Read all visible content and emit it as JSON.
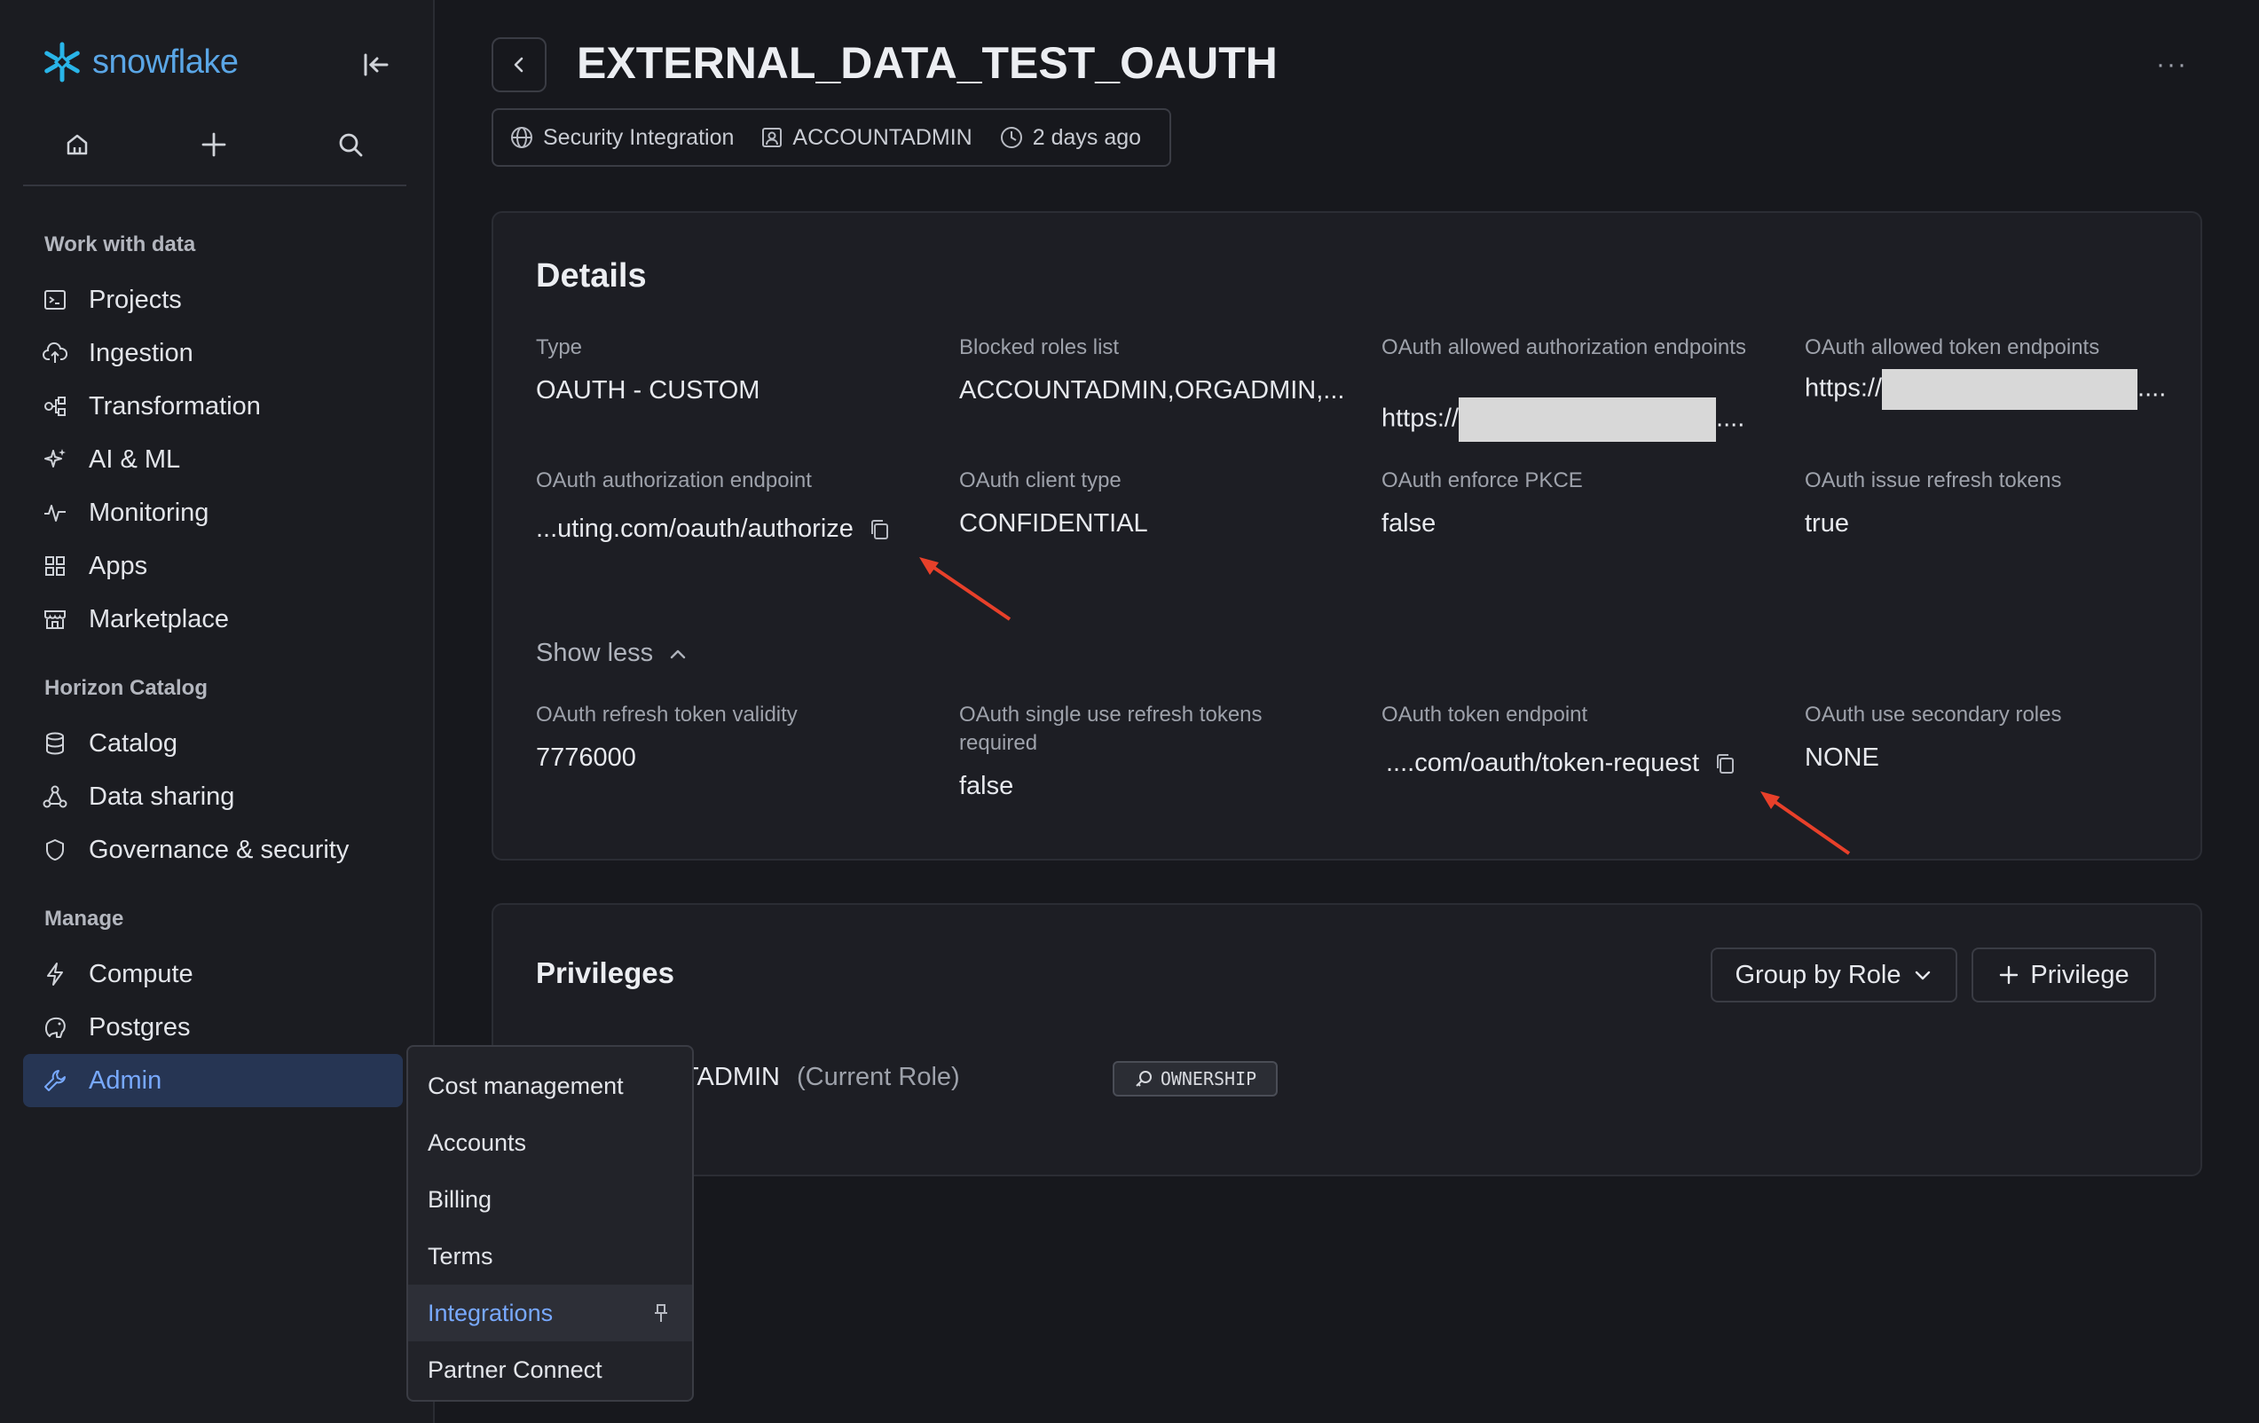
{
  "app": {
    "logo_text": "snowflake"
  },
  "sidebar": {
    "sections": [
      {
        "label": "Work with data"
      },
      {
        "label": "Horizon Catalog"
      },
      {
        "label": "Manage"
      }
    ],
    "items": [
      {
        "label": "Projects",
        "icon": "terminal-icon"
      },
      {
        "label": "Ingestion",
        "icon": "cloud-upload-icon"
      },
      {
        "label": "Transformation",
        "icon": "transform-icon"
      },
      {
        "label": "AI & ML",
        "icon": "sparkle-icon"
      },
      {
        "label": "Monitoring",
        "icon": "activity-icon"
      },
      {
        "label": "Apps",
        "icon": "grid-icon"
      },
      {
        "label": "Marketplace",
        "icon": "store-icon"
      },
      {
        "label": "Catalog",
        "icon": "database-icon"
      },
      {
        "label": "Data sharing",
        "icon": "share-icon"
      },
      {
        "label": "Governance & security",
        "icon": "shield-icon"
      },
      {
        "label": "Compute",
        "icon": "bolt-icon"
      },
      {
        "label": "Postgres",
        "icon": "elephant-icon"
      },
      {
        "label": "Admin",
        "icon": "wrench-icon",
        "active": true
      }
    ]
  },
  "submenu": {
    "items": [
      {
        "label": "Cost management"
      },
      {
        "label": "Accounts"
      },
      {
        "label": "Billing"
      },
      {
        "label": "Terms"
      },
      {
        "label": "Integrations",
        "active": true
      },
      {
        "label": "Partner Connect"
      }
    ]
  },
  "header": {
    "title": "EXTERNAL_DATA_TEST_OAUTH",
    "more": "···",
    "meta": [
      {
        "label": "Security Integration",
        "icon": "globe-icon"
      },
      {
        "label": "ACCOUNTADMIN",
        "icon": "user-badge-icon"
      },
      {
        "label": "2 days ago",
        "icon": "clock-icon"
      }
    ]
  },
  "details": {
    "title": "Details",
    "fields": [
      {
        "label": "Type",
        "value": "OAUTH - CUSTOM"
      },
      {
        "label": "Blocked roles list",
        "value": "ACCOUNTADMIN,ORGADMIN,..."
      },
      {
        "label": "OAuth allowed authorization endpoints",
        "value_prefix": "https://",
        "value_suffix": "...."
      },
      {
        "label": "OAuth allowed token endpoints",
        "value_prefix": "https://",
        "value_suffix": "...."
      },
      {
        "label": "OAuth authorization endpoint",
        "value": "...uting.com/oauth/authorize"
      },
      {
        "label": "OAuth client type",
        "value": "CONFIDENTIAL"
      },
      {
        "label": "OAuth enforce PKCE",
        "value": "false"
      },
      {
        "label": "OAuth issue refresh tokens",
        "value": "true"
      },
      {
        "label": "OAuth refresh token validity",
        "value": "7776000"
      },
      {
        "label": "OAuth single use refresh tokens required",
        "value": "false"
      },
      {
        "label": "OAuth token endpoint",
        "value": "....com/oauth/token-request"
      },
      {
        "label": "OAuth use secondary roles",
        "value": "NONE"
      }
    ],
    "show_less": "Show less"
  },
  "privileges": {
    "title": "Privileges",
    "group_by": "Group by Role",
    "add_privilege": "Privilege",
    "row": {
      "role": "TADMIN",
      "current": "(Current Role)",
      "badge": "OWNERSHIP"
    }
  },
  "colors": {
    "accent": "#78a9ff",
    "brand": "#29b5e8",
    "annotation_arrow": "#e8402a"
  }
}
